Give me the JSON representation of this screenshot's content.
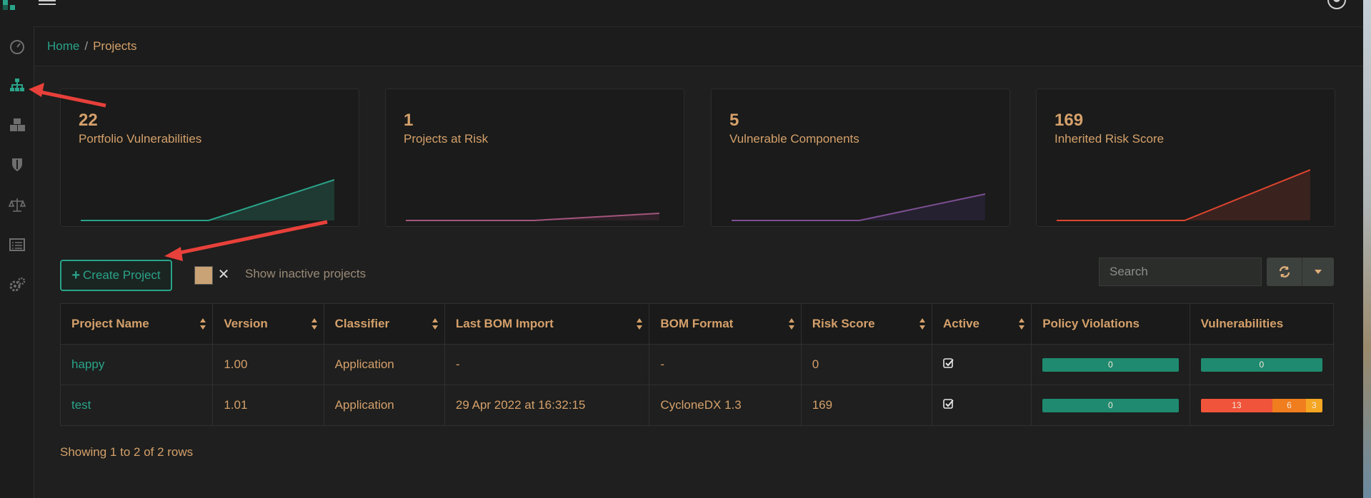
{
  "breadcrumb": {
    "home": "Home",
    "separator": "/",
    "current": "Projects"
  },
  "sidebar": {
    "items": [
      {
        "icon": "dashboard-gauge-icon"
      },
      {
        "icon": "sitemap-projects-icon",
        "active": true
      },
      {
        "icon": "cubes-components-icon"
      },
      {
        "icon": "shield-vulnerabilities-icon"
      },
      {
        "icon": "balance-scale-license-icon"
      },
      {
        "icon": "list-policy-icon"
      },
      {
        "icon": "cogs-admin-icon"
      }
    ]
  },
  "metrics": [
    {
      "value": "22",
      "label": "Portfolio Vulnerabilities",
      "color": "#2aa38a"
    },
    {
      "value": "1",
      "label": "Projects at Risk",
      "color": "#a5557d"
    },
    {
      "value": "5",
      "label": "Vulnerable Components",
      "color": "#7d4f93"
    },
    {
      "value": "169",
      "label": "Inherited Risk Score",
      "color": "#e0452f"
    }
  ],
  "toolbar": {
    "create_label": "Create Project",
    "inactive_label": "Show inactive projects",
    "search_placeholder": "Search"
  },
  "table": {
    "headers": [
      "Project Name",
      "Version",
      "Classifier",
      "Last BOM Import",
      "BOM Format",
      "Risk Score",
      "Active",
      "Policy Violations",
      "Vulnerabilities"
    ],
    "rows": [
      {
        "name": "happy",
        "version": "1.00",
        "classifier": "Application",
        "last_import": "-",
        "bom_format": "-",
        "risk_score": "0",
        "policy_violations": "0",
        "vulnerabilities": {
          "total": "0"
        }
      },
      {
        "name": "test",
        "version": "1.01",
        "classifier": "Application",
        "last_import": "29 Apr 2022 at 16:32:15",
        "bom_format": "CycloneDX 1.3",
        "risk_score": "169",
        "policy_violations": "0",
        "vulnerabilities": {
          "high": "13",
          "medium": "6",
          "low": "3"
        }
      }
    ]
  },
  "footer": {
    "pagination": "Showing 1 to 2 of 2 rows"
  },
  "colors": {
    "accent": "#2aa38a",
    "text": "#d5a06b",
    "critical": "#f0543a",
    "medium": "#f07d1e",
    "low": "#f5a623"
  }
}
